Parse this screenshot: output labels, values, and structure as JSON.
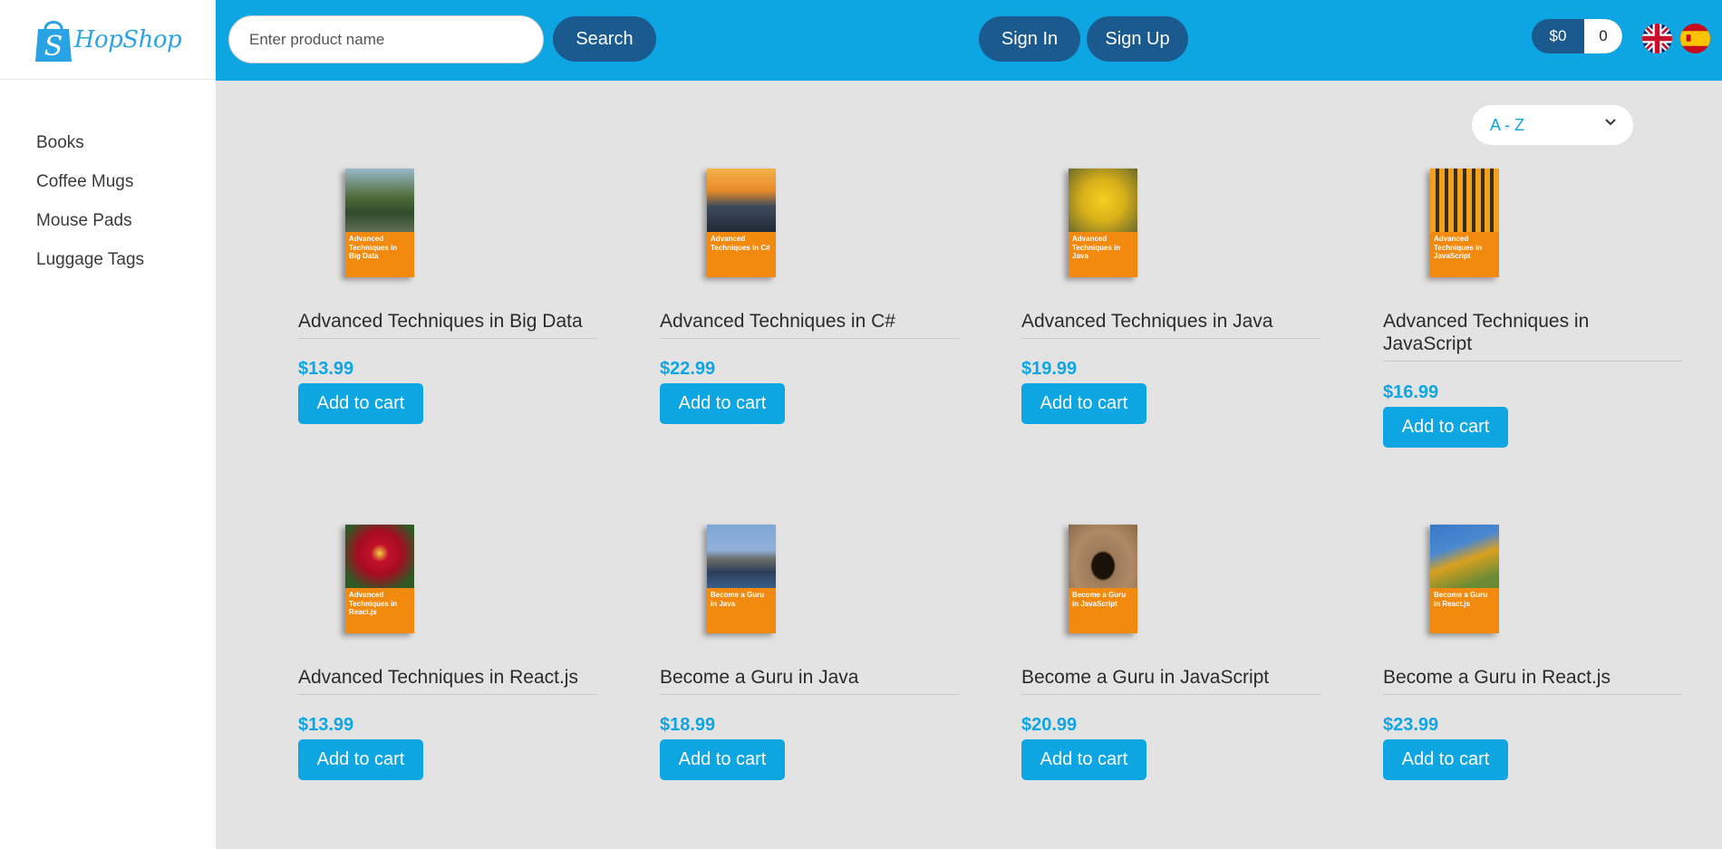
{
  "brand": {
    "name": "HopShop",
    "logo_initial": "S"
  },
  "search": {
    "placeholder": "Enter product name",
    "button_label": "Search"
  },
  "auth": {
    "sign_in": "Sign In",
    "sign_up": "Sign Up"
  },
  "cart": {
    "total": "$0",
    "count": "0"
  },
  "languages": [
    "English",
    "Español"
  ],
  "sidebar": {
    "categories": [
      "Books",
      "Coffee Mugs",
      "Mouse Pads",
      "Luggage Tags"
    ]
  },
  "sort": {
    "selected": "A - Z"
  },
  "add_to_cart_label": "Add to cart",
  "colors": {
    "accent": "#0ea5e3",
    "dark_pill": "#1b5a8e",
    "cover_orange": "#f28a10",
    "background": "#e3e3e3"
  },
  "products": [
    {
      "title": "Advanced Techniques in Big Data",
      "price": "$13.99",
      "cover_title": "Advanced Techniques in Big Data"
    },
    {
      "title": "Advanced Techniques in C#",
      "price": "$22.99",
      "cover_title": "Advanced Techniques in C#"
    },
    {
      "title": "Advanced Techniques in Java",
      "price": "$19.99",
      "cover_title": "Advanced Techniques in Java"
    },
    {
      "title": "Advanced Techniques in JavaScript",
      "price": "$16.99",
      "cover_title": "Advanced Techniques in JavaScript"
    },
    {
      "title": "Advanced Techniques in React.js",
      "price": "$13.99",
      "cover_title": "Advanced Techniques in React.js"
    },
    {
      "title": "Become a Guru in Java",
      "price": "$18.99",
      "cover_title": "Become a Guru in Java"
    },
    {
      "title": "Become a Guru in JavaScript",
      "price": "$20.99",
      "cover_title": "Become a Guru in JavaScript"
    },
    {
      "title": "Become a Guru in React.js",
      "price": "$23.99",
      "cover_title": "Become a Guru in React.js"
    }
  ]
}
